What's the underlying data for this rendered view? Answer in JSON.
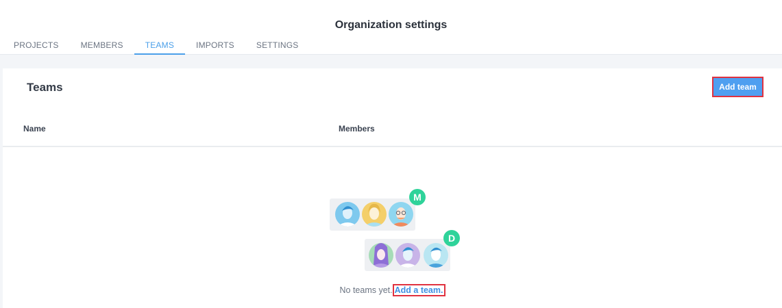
{
  "header": {
    "title": "Organization settings",
    "tabs": [
      {
        "label": "PROJECTS",
        "active": false
      },
      {
        "label": "MEMBERS",
        "active": false
      },
      {
        "label": "TEAMS",
        "active": true
      },
      {
        "label": "IMPORTS",
        "active": false
      },
      {
        "label": "SETTINGS",
        "active": false
      }
    ]
  },
  "teams": {
    "title": "Teams",
    "add_button_label": "Add team",
    "columns": [
      "Name",
      "Members"
    ],
    "empty": {
      "message": "No teams yet.",
      "link_label": "Add a team",
      "suffix": ".",
      "badges": [
        "M",
        "D"
      ]
    }
  },
  "colors": {
    "accent": "#4a9fe9",
    "button": "#4f9ff0",
    "highlight_border": "#e0313f",
    "badge": "#2fd39a"
  }
}
